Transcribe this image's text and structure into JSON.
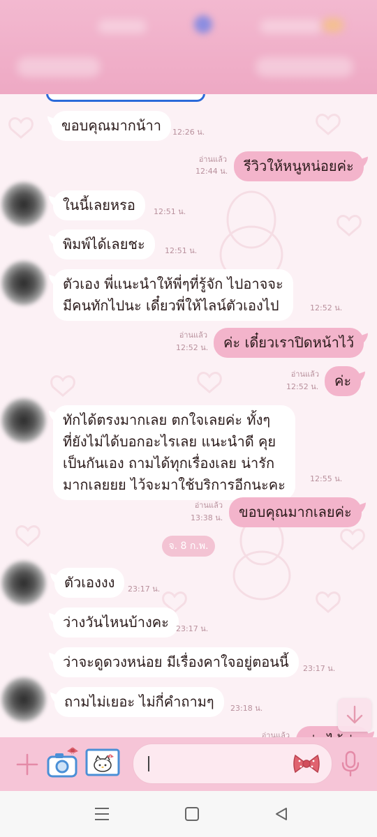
{
  "messages": [
    {
      "id": "m1",
      "side": "in",
      "text": "ขอบคุณมากน้าา",
      "time": "12:26 น."
    },
    {
      "id": "m2",
      "side": "out",
      "text": "รีวิวให้หนูหน่อยค่ะ",
      "read": "อ่านแล้ว",
      "time": "12:44 น."
    },
    {
      "id": "m3",
      "side": "in",
      "text": "ในนี้เลยหรอ",
      "time": "12:51 น."
    },
    {
      "id": "m4",
      "side": "in",
      "text": "พิมพ์ได้เลยชะ",
      "time": "12:51 น."
    },
    {
      "id": "m5",
      "side": "in",
      "text": "ตัวเอง พี่แนะนำให้พี่ๆที่รู้จัก ไปอาจจะ\nมีคนทักไปนะ เดี๋ยวพี่ให้ไลน์ตัวเองไป",
      "time": "12:52 น."
    },
    {
      "id": "m6",
      "side": "out",
      "text": "ค่ะ เดี๋ยวเราปิดหน้าไว้",
      "read": "อ่านแล้ว",
      "time": "12:52 น."
    },
    {
      "id": "m7",
      "side": "out",
      "text": "ค่ะ",
      "read": "อ่านแล้ว",
      "time": "12:52 น."
    },
    {
      "id": "m8",
      "side": "in",
      "text": "ทักได้ตรงมากเลย ตกใจเลยค่ะ ทั้งๆ\nที่ยังไม่ได้บอกอะไรเลย แนะนำดี คุย\nเป็นกันเอง ถามได้ทุกเรื่องเลย น่ารัก\nมากเลยยย ไว้จะมาใช้บริการอีกนะคะ",
      "time": "12:55 น."
    },
    {
      "id": "m9",
      "side": "out",
      "text": "ขอบคุณมากเลยค่ะ",
      "read": "อ่านแล้ว",
      "time": "13:38 น."
    },
    {
      "id": "m10",
      "side": "in",
      "text": "ตัวเองงง",
      "time": "23:17 น."
    },
    {
      "id": "m11",
      "side": "in",
      "text": "ว่างวันไหนบ้างคะ",
      "time": "23:17 น."
    },
    {
      "id": "m12",
      "side": "in",
      "text": "ว่าจะดูดวงหน่อย มีเรื่องคาใจอยู่ตอนนี้",
      "time": "23:17 น."
    },
    {
      "id": "m13",
      "side": "in",
      "text": "ถามไม่เยอะ ไม่กี่คำถามๆ",
      "time": "23:18 น."
    },
    {
      "id": "m14",
      "side": "out",
      "text": "ค่ะ ได้ค่ะ",
      "read": "อ่านแล้ว",
      "time": ""
    }
  ],
  "date_separator": "จ. 8 ก.พ.",
  "colors": {
    "accent": "#f3b4cb",
    "header": "#eea9c4",
    "inputbar": "#f6c5d7",
    "bow": "#e0636f"
  },
  "icons": {
    "input_bar": [
      "plus-icon",
      "camera-sticker-icon",
      "hello-kitty-image-icon",
      "bow-sticker-icon",
      "microphone-icon"
    ],
    "nav": [
      "menu-icon",
      "home-icon",
      "back-icon"
    ],
    "chat": [
      "scroll-down-icon"
    ]
  }
}
